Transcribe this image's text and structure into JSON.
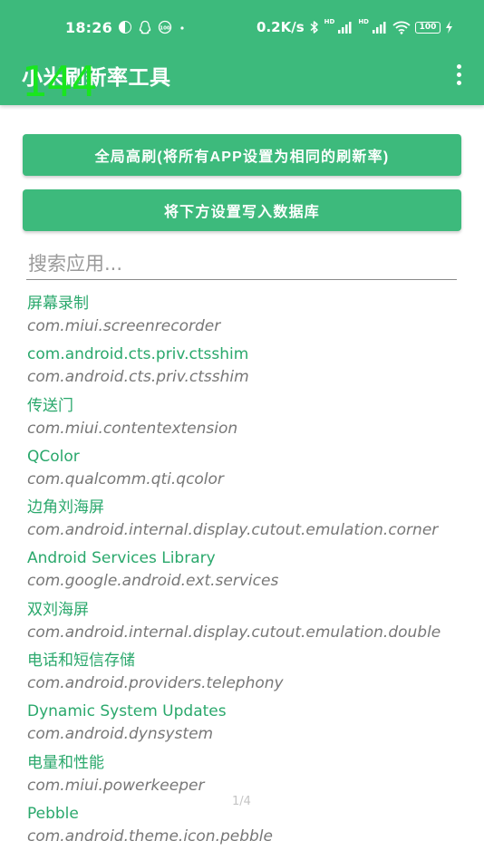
{
  "status_bar": {
    "time": "18:26",
    "net_speed": "0.2K/s",
    "hd1": "HD",
    "hd2": "HD",
    "battery": "100",
    "icons": [
      "circle-badge-icon",
      "penguin-icon",
      "percent-badge-icon",
      "dot-icon",
      "bluetooth-icon",
      "signal-icon",
      "signal-icon",
      "wifi-icon",
      "battery-icon",
      "charging-icon"
    ]
  },
  "app_bar": {
    "title": "小米刷新率工具",
    "fps_overlay": "144",
    "menu_icon": "more-vertical-icon"
  },
  "buttons": {
    "global": "全局高刷(将所有APP设置为相同的刷新率)",
    "write": "将下方设置写入数据库"
  },
  "search": {
    "placeholder": "搜索应用...",
    "value": ""
  },
  "apps": [
    {
      "name": "屏幕录制",
      "package": "com.miui.screenrecorder"
    },
    {
      "name": "com.android.cts.priv.ctsshim",
      "package": "com.android.cts.priv.ctsshim"
    },
    {
      "name": "传送门",
      "package": "com.miui.contentextension"
    },
    {
      "name": "QColor",
      "package": "com.qualcomm.qti.qcolor"
    },
    {
      "name": "边角刘海屏",
      "package": "com.android.internal.display.cutout.emulation.corner"
    },
    {
      "name": "Android Services Library",
      "package": "com.google.android.ext.services"
    },
    {
      "name": "双刘海屏",
      "package": "com.android.internal.display.cutout.emulation.double"
    },
    {
      "name": "电话和短信存储",
      "package": "com.android.providers.telephony"
    },
    {
      "name": "Dynamic System Updates",
      "package": "com.android.dynsystem"
    },
    {
      "name": "电量和性能",
      "package": "com.miui.powerkeeper"
    },
    {
      "name": "Pebble",
      "package": "com.android.theme.icon.pebble"
    }
  ],
  "page_indicator": "1/4",
  "colors": {
    "primary": "#3dba7c",
    "accent_text": "#2aa86c",
    "overlay": "#19e61e"
  }
}
